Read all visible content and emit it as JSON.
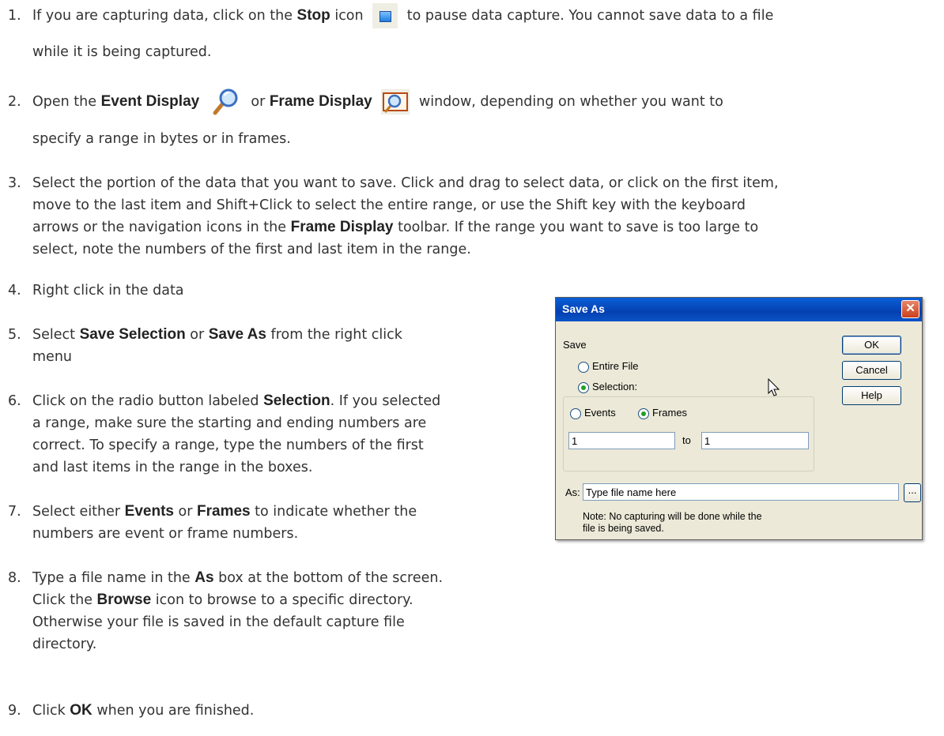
{
  "steps": [
    {
      "num": "1.",
      "pre": "If you are capturing data, click on the ",
      "b1": "Stop",
      "mid": " icon",
      "post": "to pause data capture. You cannot save data to a file",
      "cont": "while it is being captured."
    },
    {
      "num": "2.",
      "pre": "Open the ",
      "b1": "Event Display",
      "mid": "or ",
      "b2": "Frame Display",
      "post": "window, depending on whether you want to",
      "cont": "specify a range in bytes or in frames."
    },
    {
      "num": "3.",
      "lines": [
        "Select the portion of the data that you want to save. Click and drag to select data, or click on the first item,",
        "move to the last item and Shift+Click to select the entire range, or use the Shift key with the keyboard",
        "arrows or the navigation icons in the ",
        "toolbar. If the range you want to save is too large to",
        "select, note the numbers of the first and last item in the range."
      ],
      "b1": "Frame Display"
    },
    {
      "num": "4.",
      "text": "Right click in the data"
    },
    {
      "num": "5.",
      "pre": "Select ",
      "b1": "Save Selection",
      "mid": " or ",
      "b2": "Save As",
      "post": " from the right click",
      "cont": "menu"
    },
    {
      "num": "6.",
      "pre": "Click on the radio button labeled ",
      "b1": "Selection",
      "post": ". If you selected",
      "lines": [
        "a range, make sure the starting and ending numbers are",
        "correct. To specify a range, type the numbers of the first",
        "and last items in the range in the boxes."
      ]
    },
    {
      "num": "7.",
      "pre": "Select either ",
      "b1": "Events",
      "mid": " or ",
      "b2": "Frames",
      "post": " to indicate whether the",
      "cont": "numbers are event or frame numbers."
    },
    {
      "num": "8.",
      "pre": "Type a file name in the ",
      "b1": "As",
      "post": " box at the bottom of the screen.",
      "pre2": "Click the ",
      "b2": "Browse",
      "post2": " icon to browse to a specific directory.",
      "lines": [
        "Otherwise your file is saved in the default capture file",
        "directory."
      ]
    },
    {
      "num": "9.",
      "pre": "Click ",
      "b1": "OK",
      "post": " when you are finished."
    }
  ],
  "dialog": {
    "title": "Save As",
    "close": "✕",
    "save_label": "Save",
    "entire_file": "Entire File",
    "selection": "Selection:",
    "events": "Events",
    "frames": "Frames",
    "from_value": "1",
    "to_label": "to",
    "to_value": "1",
    "as_label": "As:",
    "file_name": "Type file name here",
    "browse": "...",
    "ok": "OK",
    "cancel": "Cancel",
    "help": "Help",
    "note_line1": "Note: No capturing will be done while the",
    "note_line2": "file is being saved."
  },
  "icons": [
    "stop-icon",
    "event-display-icon",
    "frame-display-icon",
    "cursor-icon"
  ]
}
